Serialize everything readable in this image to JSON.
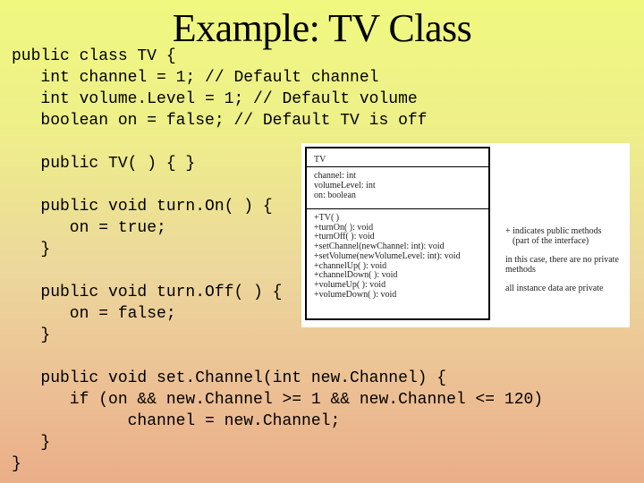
{
  "title": "Example:  TV Class",
  "code_lines": [
    "public class TV {",
    "   int channel = 1; // Default channel",
    "   int volume.Level = 1; // Default volume",
    "   boolean on = false; // Default TV is off",
    "",
    "   public TV( ) { }",
    "",
    "   public void turn.On( ) {",
    "      on = true;",
    "   }",
    "",
    "   public void turn.Off( ) {",
    "      on = false;",
    "   }",
    "",
    "   public void set.Channel(int new.Channel) {",
    "      if (on && new.Channel >= 1 && new.Channel <= 120)",
    "            channel = new.Channel;",
    "   }",
    "}"
  ],
  "uml": {
    "class_name": "TV",
    "attributes": [
      "channel: int",
      "volumeLevel: int",
      "on: boolean"
    ],
    "operations": [
      "+TV( )",
      "+turnOn( ): void",
      "+turnOff( ): void",
      "+setChannel(newChannel: int): void",
      "+setVolume(newVolumeLevel: int): void",
      "+channelUp( ): void",
      "+channelDown( ): void",
      "+volumeUp( ): void",
      "+volumeDown( ): void"
    ]
  },
  "notes": {
    "public_line1": "+ indicates public methods",
    "public_line2": "(part of the interface)",
    "private_methods": "in this case, there are no private methods",
    "private_data": "all instance data are private"
  }
}
